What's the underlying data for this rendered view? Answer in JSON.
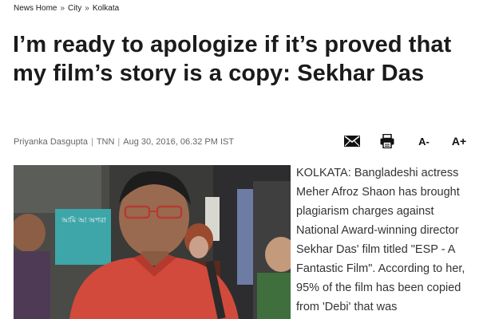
{
  "breadcrumb": {
    "items": [
      "News Home",
      "City",
      "Kolkata"
    ],
    "separator": "»"
  },
  "article": {
    "headline": "I’m ready to apologize if it’s proved that my film’s story is a copy: Sekhar Das",
    "byline": {
      "author": "Priyanka Dasgupta",
      "source": "TNN",
      "datetime": "Aug 30, 2016, 06.32 PM IST"
    },
    "body": "KOLKATA: Bangladeshi actress Meher Afroz Shaon has brought plagiarism charges against National Award-winning director Sekhar Das' film titled \"ESP - A Fantastic Film\". According to her, 95% of the film has been copied from 'Debi' that was"
  },
  "tools": {
    "mail_icon": "envelope-icon",
    "print_icon": "printer-icon",
    "font_decrease": "A-",
    "font_increase": "A+"
  },
  "photo": {
    "poster_text": "আমি আ অপরা"
  },
  "colors": {
    "headline": "#1b1b1b",
    "byline": "#666666",
    "body": "#333333"
  }
}
